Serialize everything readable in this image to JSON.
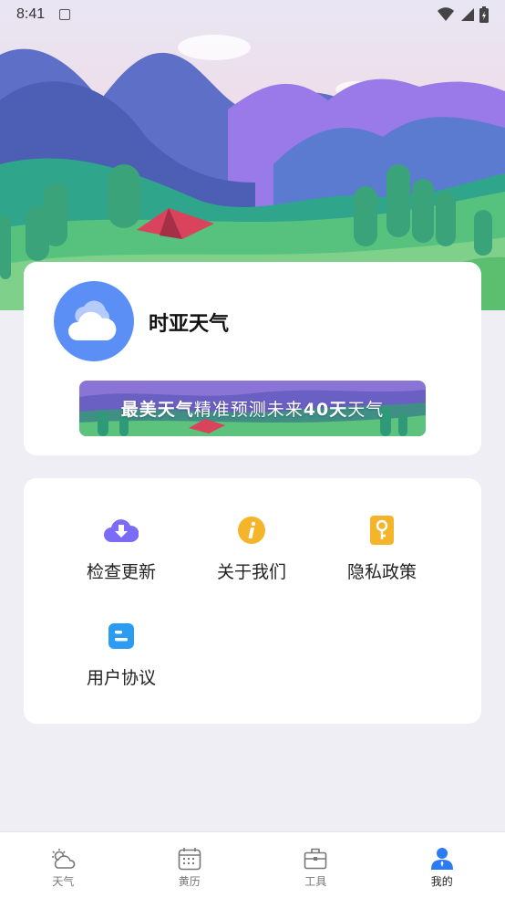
{
  "status_bar": {
    "time": "8:41"
  },
  "profile": {
    "app_name": "时亚天气",
    "banner": {
      "part1": "最美天气",
      "part2": "精准预测未来",
      "part3": "40天",
      "part4": "天气"
    }
  },
  "menu": {
    "items": [
      {
        "label": "检查更新",
        "icon": "cloud-download-icon",
        "color": "#7b6cf6"
      },
      {
        "label": "关于我们",
        "icon": "info-icon",
        "color": "#f5b52b"
      },
      {
        "label": "隐私政策",
        "icon": "key-icon",
        "color": "#f5b52b"
      },
      {
        "label": "用户协议",
        "icon": "document-icon",
        "color": "#2b9cf2"
      }
    ]
  },
  "tabbar": {
    "tabs": [
      {
        "label": "天气",
        "icon": "weather-icon",
        "active": false
      },
      {
        "label": "黄历",
        "icon": "calendar-icon",
        "active": false
      },
      {
        "label": "工具",
        "icon": "toolbox-icon",
        "active": false
      },
      {
        "label": "我的",
        "icon": "user-icon",
        "active": true
      }
    ],
    "active_color": "#2b7cf2"
  }
}
